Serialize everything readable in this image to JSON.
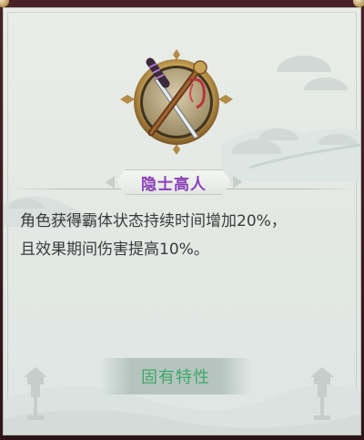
{
  "skill": {
    "name": "隐士高人",
    "description_line1": "角色获得霸体状态持续时间增加20%，",
    "description_line2": "且效果期间伤害提高10%。",
    "tag": "固有特性",
    "icon": "crossed-dagger-and-cane-icon"
  },
  "colors": {
    "name": "#8b3fb8",
    "description": "#3b3b3b",
    "tag": "#3fa86a",
    "card_background": "#e6ebe6"
  }
}
